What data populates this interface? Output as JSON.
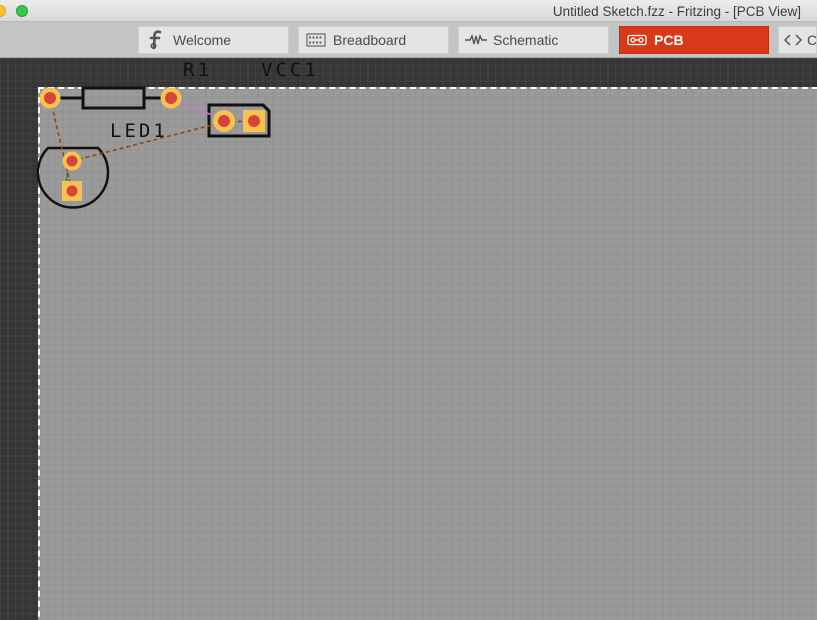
{
  "window": {
    "title": "Untitled Sketch.fzz - Fritzing - [PCB View]"
  },
  "tabs": [
    {
      "label": "Welcome",
      "icon": "fritzing-logo-icon",
      "active": false
    },
    {
      "label": "Breadboard",
      "icon": "breadboard-icon",
      "active": false
    },
    {
      "label": "Schematic",
      "icon": "resistor-symbol-icon",
      "active": false
    },
    {
      "label": "PCB",
      "icon": "pcb-icon",
      "active": true
    },
    {
      "label": "C",
      "icon": "code-icon",
      "active": false
    }
  ],
  "pcb": {
    "parts": [
      {
        "label": "R1",
        "type": "resistor"
      },
      {
        "label": "VCC1",
        "type": "power-header"
      },
      {
        "label": "LED1",
        "type": "led"
      }
    ]
  },
  "colors": {
    "active_tab": "#d9391b",
    "board": "#9a9a9a",
    "workspace": "#363636",
    "pad_outer": "#f7c24f",
    "pad_inner": "#d9443a",
    "ratsnest": "#8a4a10",
    "ratsnest_pink": "#c77ac7"
  }
}
